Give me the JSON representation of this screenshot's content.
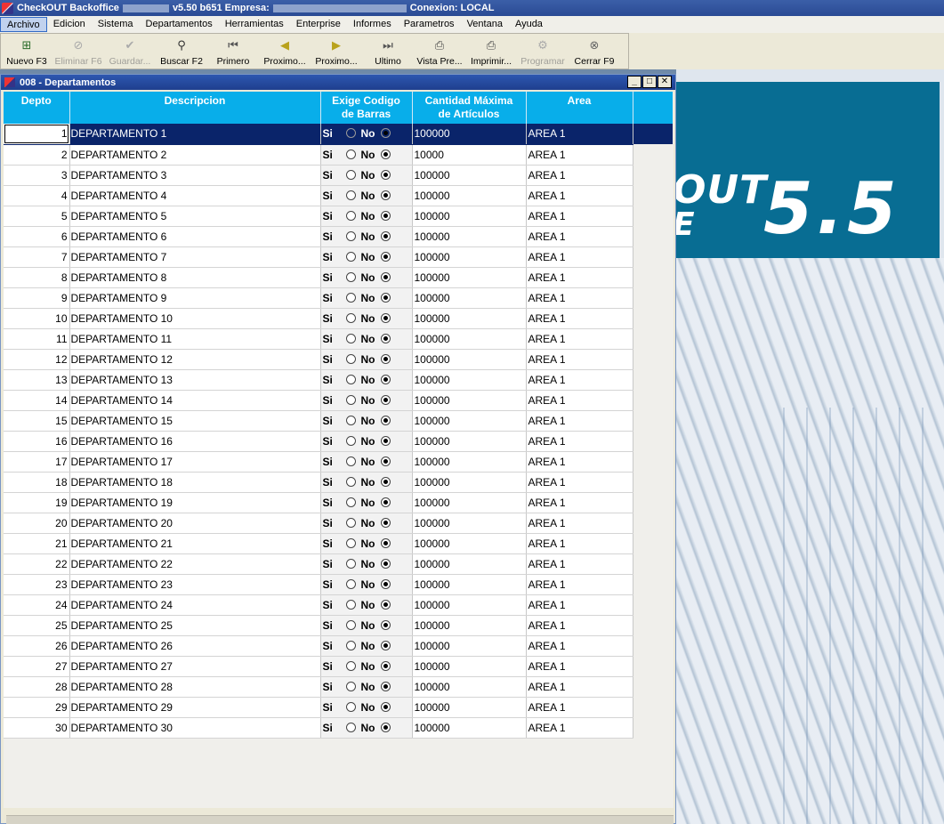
{
  "window": {
    "title_app": "CheckOUT Backoffice",
    "title_version": "v5.50 b651 Empresa:",
    "title_connection": "Conexion: LOCAL"
  },
  "menu": [
    "Archivo",
    "Edicion",
    "Sistema",
    "Departamentos",
    "Herramientas",
    "Enterprise",
    "Informes",
    "Parametros",
    "Ventana",
    "Ayuda"
  ],
  "toolbar": [
    {
      "label": "Nuevo F3",
      "icon": "new-icon",
      "enabled": true
    },
    {
      "label": "Eliminar F6",
      "icon": "delete-icon",
      "enabled": false
    },
    {
      "label": "Guardar...",
      "icon": "save-icon",
      "enabled": false
    },
    {
      "label": "Buscar F2",
      "icon": "search-icon",
      "enabled": true
    },
    {
      "label": "Primero",
      "icon": "first-icon",
      "enabled": true
    },
    {
      "label": "Proximo...",
      "icon": "previous-icon",
      "enabled": true
    },
    {
      "label": "Proximo...",
      "icon": "next-icon",
      "enabled": true
    },
    {
      "label": "Ultimo",
      "icon": "last-icon",
      "enabled": true
    },
    {
      "label": "Vista Pre...",
      "icon": "print-preview-icon",
      "enabled": true
    },
    {
      "label": "Imprimir...",
      "icon": "print-icon",
      "enabled": true
    },
    {
      "label": "Programar",
      "icon": "schedule-icon",
      "enabled": false
    },
    {
      "label": "Cerrar F9",
      "icon": "close-icon",
      "enabled": true
    }
  ],
  "child_window": {
    "title": "008 - Departamentos",
    "min": "_",
    "max": "□",
    "close": "✕"
  },
  "grid": {
    "headers": {
      "depto": "Depto",
      "descripcion": "Descripcion",
      "exige_line1": "Exige Codigo",
      "exige_line2": "de Barras",
      "cantidad_line1": "Cantidad Máxima",
      "cantidad_line2": "de Artículos",
      "area": "Area"
    },
    "si_label": "Si",
    "no_label": "No",
    "selected_row": 0,
    "rows": [
      {
        "depto": "1",
        "descripcion": "DEPARTAMENTO 1",
        "exige": "No",
        "cantidad": "100000",
        "area": "AREA 1"
      },
      {
        "depto": "2",
        "descripcion": "DEPARTAMENTO 2",
        "exige": "No",
        "cantidad": "10000",
        "area": "AREA 1"
      },
      {
        "depto": "3",
        "descripcion": "DEPARTAMENTO 3",
        "exige": "No",
        "cantidad": "100000",
        "area": "AREA 1"
      },
      {
        "depto": "4",
        "descripcion": "DEPARTAMENTO 4",
        "exige": "No",
        "cantidad": "100000",
        "area": "AREA 1"
      },
      {
        "depto": "5",
        "descripcion": "DEPARTAMENTO 5",
        "exige": "No",
        "cantidad": "100000",
        "area": "AREA 1"
      },
      {
        "depto": "6",
        "descripcion": "DEPARTAMENTO 6",
        "exige": "No",
        "cantidad": "100000",
        "area": "AREA 1"
      },
      {
        "depto": "7",
        "descripcion": "DEPARTAMENTO 7",
        "exige": "No",
        "cantidad": "100000",
        "area": "AREA 1"
      },
      {
        "depto": "8",
        "descripcion": "DEPARTAMENTO 8",
        "exige": "No",
        "cantidad": "100000",
        "area": "AREA 1"
      },
      {
        "depto": "9",
        "descripcion": "DEPARTAMENTO 9",
        "exige": "No",
        "cantidad": "100000",
        "area": "AREA 1"
      },
      {
        "depto": "10",
        "descripcion": "DEPARTAMENTO 10",
        "exige": "No",
        "cantidad": "100000",
        "area": "AREA 1"
      },
      {
        "depto": "11",
        "descripcion": "DEPARTAMENTO 11",
        "exige": "No",
        "cantidad": "100000",
        "area": "AREA 1"
      },
      {
        "depto": "12",
        "descripcion": "DEPARTAMENTO 12",
        "exige": "No",
        "cantidad": "100000",
        "area": "AREA 1"
      },
      {
        "depto": "13",
        "descripcion": "DEPARTAMENTO 13",
        "exige": "No",
        "cantidad": "100000",
        "area": "AREA 1"
      },
      {
        "depto": "14",
        "descripcion": "DEPARTAMENTO 14",
        "exige": "No",
        "cantidad": "100000",
        "area": "AREA 1"
      },
      {
        "depto": "15",
        "descripcion": "DEPARTAMENTO 15",
        "exige": "No",
        "cantidad": "100000",
        "area": "AREA 1"
      },
      {
        "depto": "16",
        "descripcion": "DEPARTAMENTO 16",
        "exige": "No",
        "cantidad": "100000",
        "area": "AREA 1"
      },
      {
        "depto": "17",
        "descripcion": "DEPARTAMENTO 17",
        "exige": "No",
        "cantidad": "100000",
        "area": "AREA 1"
      },
      {
        "depto": "18",
        "descripcion": "DEPARTAMENTO 18",
        "exige": "No",
        "cantidad": "100000",
        "area": "AREA 1"
      },
      {
        "depto": "19",
        "descripcion": "DEPARTAMENTO 19",
        "exige": "No",
        "cantidad": "100000",
        "area": "AREA 1"
      },
      {
        "depto": "20",
        "descripcion": "DEPARTAMENTO 20",
        "exige": "No",
        "cantidad": "100000",
        "area": "AREA 1"
      },
      {
        "depto": "21",
        "descripcion": "DEPARTAMENTO 21",
        "exige": "No",
        "cantidad": "100000",
        "area": "AREA 1"
      },
      {
        "depto": "22",
        "descripcion": "DEPARTAMENTO 22",
        "exige": "No",
        "cantidad": "100000",
        "area": "AREA 1"
      },
      {
        "depto": "23",
        "descripcion": "DEPARTAMENTO 23",
        "exige": "No",
        "cantidad": "100000",
        "area": "AREA 1"
      },
      {
        "depto": "24",
        "descripcion": "DEPARTAMENTO 24",
        "exige": "No",
        "cantidad": "100000",
        "area": "AREA 1"
      },
      {
        "depto": "25",
        "descripcion": "DEPARTAMENTO 25",
        "exige": "No",
        "cantidad": "100000",
        "area": "AREA 1"
      },
      {
        "depto": "26",
        "descripcion": "DEPARTAMENTO 26",
        "exige": "No",
        "cantidad": "100000",
        "area": "AREA 1"
      },
      {
        "depto": "27",
        "descripcion": "DEPARTAMENTO 27",
        "exige": "No",
        "cantidad": "100000",
        "area": "AREA 1"
      },
      {
        "depto": "28",
        "descripcion": "DEPARTAMENTO 28",
        "exige": "No",
        "cantidad": "100000",
        "area": "AREA 1"
      },
      {
        "depto": "29",
        "descripcion": "DEPARTAMENTO 29",
        "exige": "No",
        "cantidad": "100000",
        "area": "AREA 1"
      },
      {
        "depto": "30",
        "descripcion": "DEPARTAMENTO 30",
        "exige": "No",
        "cantidad": "100000",
        "area": "AREA 1"
      }
    ]
  },
  "wallpaper": {
    "brand_fragment_1": "OUT",
    "brand_fragment_2": "E",
    "version": "5.5"
  },
  "colors": {
    "header_bg": "#08aeea",
    "selection": "#0a246a",
    "banner": "#086d93"
  }
}
